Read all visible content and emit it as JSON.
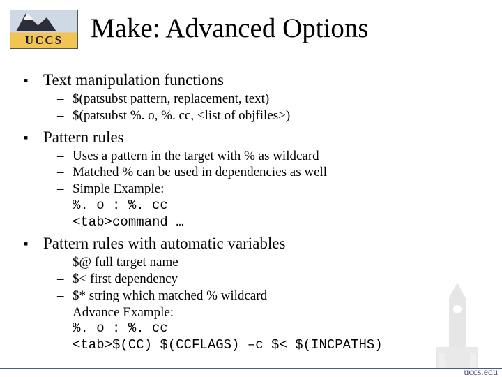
{
  "logo_text": "UCCS",
  "title": "Make: Advanced Options",
  "sections": [
    {
      "heading": "Text manipulation functions",
      "items": [
        {
          "text": "$(patsubst pattern, replacement, text)"
        },
        {
          "text": "$(patsubst %. o, %. cc, <list of objfiles>)"
        }
      ]
    },
    {
      "heading": "Pattern rules",
      "items": [
        {
          "text": "Uses a pattern in the target with % as wildcard"
        },
        {
          "text": "Matched % can be used in dependencies as well"
        },
        {
          "text": "Simple Example:"
        }
      ],
      "code": [
        "%. o : %. cc",
        "<tab>command …"
      ]
    },
    {
      "heading": "Pattern rules with automatic variables",
      "items": [
        {
          "text": "$@ full target name"
        },
        {
          "text": "$< first dependency"
        },
        {
          "text": "$* string which matched % wildcard"
        },
        {
          "text": "Advance Example:"
        }
      ],
      "code": [
        "%. o : %. cc",
        "<tab>$(CC) $(CCFLAGS) –c $< $(INCPATHS)"
      ]
    }
  ],
  "footer_url": "uccs.edu"
}
